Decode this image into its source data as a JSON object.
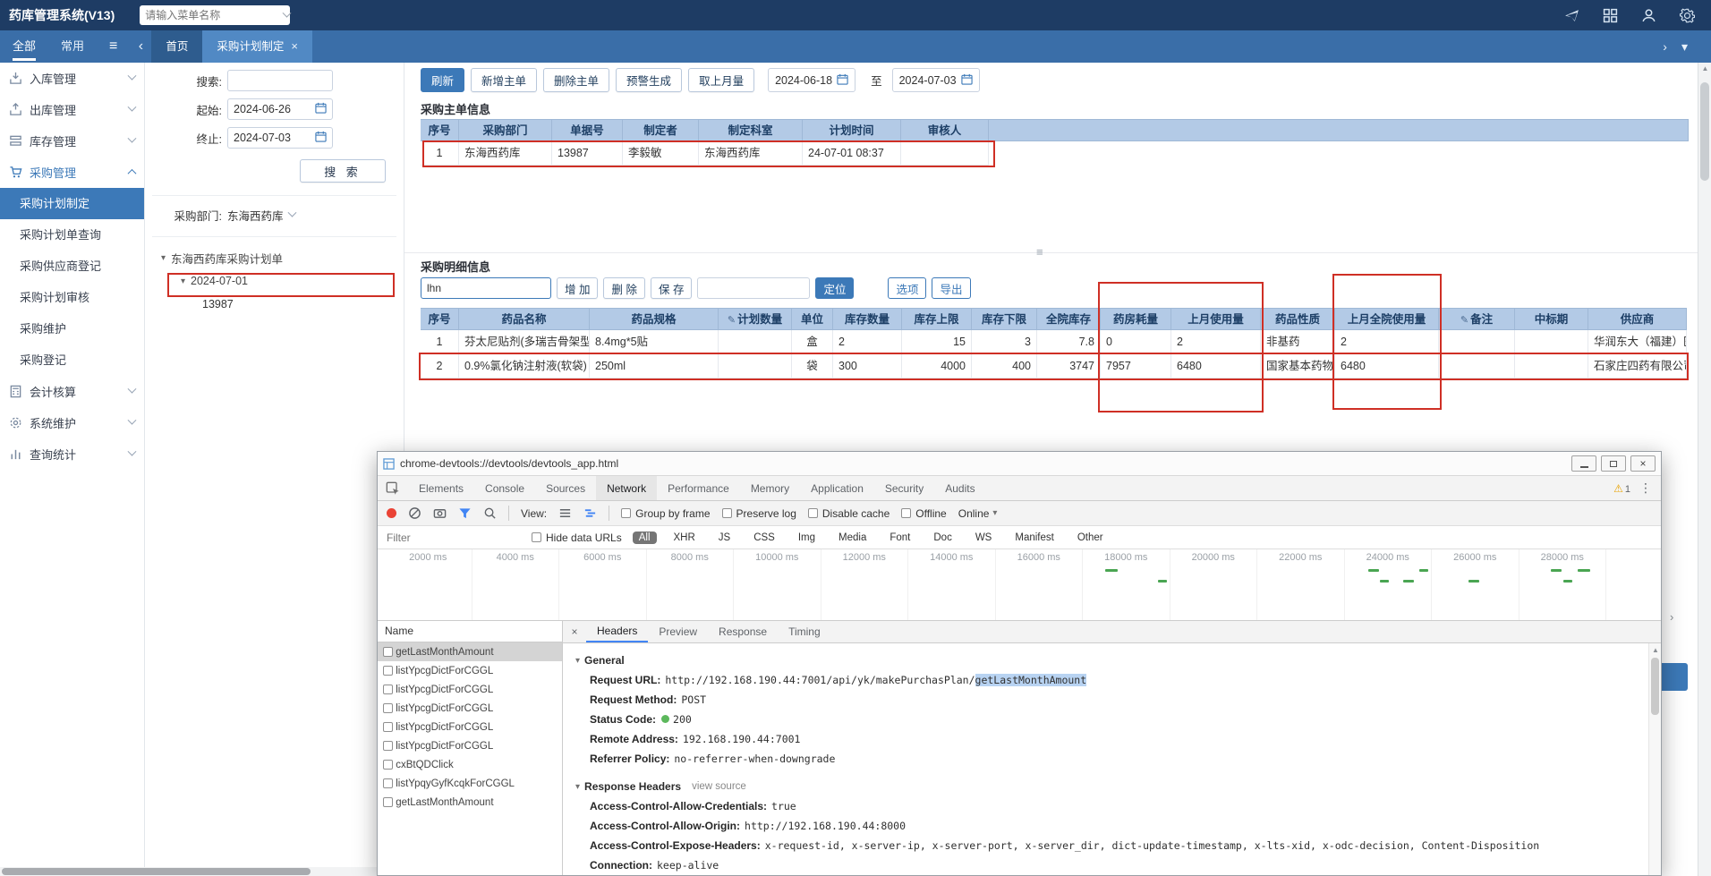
{
  "colors": {
    "navy": "#1e3c64",
    "bar": "#3a6ea8",
    "accent": "#3c79b8",
    "tab_active": "#2e5c8e",
    "tab_light": "#5189c4",
    "grid_header": "#b3cae6",
    "grid_header_text": "#1d3f66",
    "annotation": "#cf2f25",
    "devtools_blue": "#4285f4",
    "status_green": "#5cb85c",
    "mark_green": "#4aa552"
  },
  "icons": {
    "tri": "▾",
    "close": "×",
    "kebab": "⋮",
    "warning": "⚠",
    "hamburger": "≡",
    "back": "‹",
    "forward": "›",
    "caret_down": "▾",
    "up_arrow": "▲",
    "edit": "✎"
  },
  "app": {
    "title": "药库管理系统(V13)",
    "menu_search_placeholder": "请输入菜单名称"
  },
  "secondbar": {
    "all_label": "全部",
    "common_label": "常用",
    "tabs": [
      {
        "label": "首页"
      },
      {
        "label": "采购计划制定"
      }
    ]
  },
  "sidebar": {
    "items": [
      {
        "label": "入库管理"
      },
      {
        "label": "出库管理"
      },
      {
        "label": "库存管理"
      },
      {
        "label": "采购管理",
        "children": [
          {
            "label": "采购计划制定"
          },
          {
            "label": "采购计划单查询"
          },
          {
            "label": "采购供应商登记"
          },
          {
            "label": "采购计划审核"
          },
          {
            "label": "采购维护"
          },
          {
            "label": "采购登记"
          }
        ]
      },
      {
        "label": "会计核算"
      },
      {
        "label": "系统维护"
      },
      {
        "label": "查询统计"
      }
    ]
  },
  "search_panel": {
    "search_label": "搜索:",
    "search_value": "",
    "start_label": "起始:",
    "start_value": "2024-06-26",
    "end_label": "终止:",
    "end_value": "2024-07-03",
    "search_button": "搜 索",
    "dept_label": "采购部门:",
    "dept_value": "东海西药库",
    "tree": {
      "root": "东海西药库采购计划单",
      "date": "2024-07-01",
      "doc": "13987"
    }
  },
  "toolbar": {
    "refresh": "刷新",
    "add_master": "新增主单",
    "delete_master": "删除主单",
    "warning_generate": "预警生成",
    "take_last_month": "取上月量",
    "date_from": "2024-06-18",
    "to_label": "至",
    "date_to": "2024-07-03"
  },
  "master": {
    "title": "采购主单信息",
    "headers": [
      "序号",
      "采购部门",
      "单据号",
      "制定者",
      "制定科室",
      "计划时间",
      "审核人"
    ],
    "rows": [
      [
        "1",
        "东海西药库",
        "13987",
        "李毅敏",
        "东海西药库",
        "24-07-01 08:37",
        ""
      ]
    ]
  },
  "detail": {
    "title": "采购明细信息",
    "filter_value": "lhn",
    "filter2_value": "",
    "add": "增 加",
    "delete": "删 除",
    "save": "保 存",
    "locate": "定位",
    "options": "选项",
    "export": "导出",
    "headers": [
      "序号",
      "药品名称",
      "药品规格",
      "计划数量",
      "单位",
      "库存数量",
      "库存上限",
      "库存下限",
      "全院库存",
      "药房耗量",
      "上月使用量",
      "药品性质",
      "上月全院使用量",
      "备注",
      "中标期",
      "供应商"
    ],
    "rows": [
      [
        "1",
        "芬太尼贴剂(多瑞吉骨架型)",
        "8.4mg*5贴",
        "",
        "盒",
        "2",
        "15",
        "3",
        "7.8",
        "0",
        "2",
        "非基药",
        "2",
        "",
        "",
        "华润东大（福建）医"
      ],
      [
        "2",
        "0.9%氯化钠注射液(软袋)",
        "250ml",
        "",
        "袋",
        "300",
        "4000",
        "400",
        "3747",
        "7957",
        "6480",
        "国家基本药物",
        "6480",
        "",
        "",
        "石家庄四药有限公司"
      ]
    ]
  },
  "devtools": {
    "title": "chrome-devtools://devtools/devtools_app.html",
    "tabs": [
      "Elements",
      "Console",
      "Sources",
      "Network",
      "Performance",
      "Memory",
      "Application",
      "Security",
      "Audits"
    ],
    "active_tab": "Network",
    "warning_count": "1",
    "toolbar": {
      "view_label": "View:",
      "group_by_frame": "Group by frame",
      "preserve_log": "Preserve log",
      "disable_cache": "Disable cache",
      "offline": "Offline",
      "online": "Online"
    },
    "filter": {
      "placeholder": "Filter",
      "hide_data_urls": "Hide data URLs",
      "types": [
        "All",
        "XHR",
        "JS",
        "CSS",
        "Img",
        "Media",
        "Font",
        "Doc",
        "WS",
        "Manifest",
        "Other"
      ],
      "active_type": "All"
    },
    "timeline_ticks": [
      "2000 ms",
      "4000 ms",
      "6000 ms",
      "8000 ms",
      "10000 ms",
      "12000 ms",
      "14000 ms",
      "16000 ms",
      "18000 ms",
      "20000 ms",
      "22000 ms",
      "24000 ms",
      "26000 ms",
      "28000 ms"
    ],
    "requests": {
      "header": "Name",
      "items": [
        "getLastMonthAmount",
        "listYpcgDictForCGGL",
        "listYpcgDictForCGGL",
        "listYpcgDictForCGGL",
        "listYpcgDictForCGGL",
        "listYpcgDictForCGGL",
        "cxBtQDClick",
        "listYpqyGyfKcqkForCGGL",
        "getLastMonthAmount"
      ],
      "selected_index": 0
    },
    "request_tabs": [
      "Headers",
      "Preview",
      "Response",
      "Timing"
    ],
    "active_request_tab": "Headers",
    "general": {
      "section": "General",
      "request_url_key": "Request URL:",
      "request_url_prefix": "http://192.168.190.44:7001/api/yk/makePurchasPlan/",
      "request_url_highlight": "getLastMonthAmount",
      "request_method_key": "Request Method:",
      "request_method": "POST",
      "status_key": "Status Code:",
      "status": "200",
      "remote_key": "Remote Address:",
      "remote": "192.168.190.44:7001",
      "referrer_key": "Referrer Policy:",
      "referrer": "no-referrer-when-downgrade"
    },
    "response_headers": {
      "section": "Response Headers",
      "view_source": "view source",
      "entries": [
        {
          "key": "Access-Control-Allow-Credentials:",
          "value": "true"
        },
        {
          "key": "Access-Control-Allow-Origin:",
          "value": "http://192.168.190.44:8000"
        },
        {
          "key": "Access-Control-Expose-Headers:",
          "value": "x-request-id, x-server-ip, x-server-port, x-server_dir, dict-update-timestamp, x-lts-xid, x-odc-decision, Content-Disposition"
        },
        {
          "key": "Connection:",
          "value": "keep-alive"
        }
      ]
    }
  }
}
